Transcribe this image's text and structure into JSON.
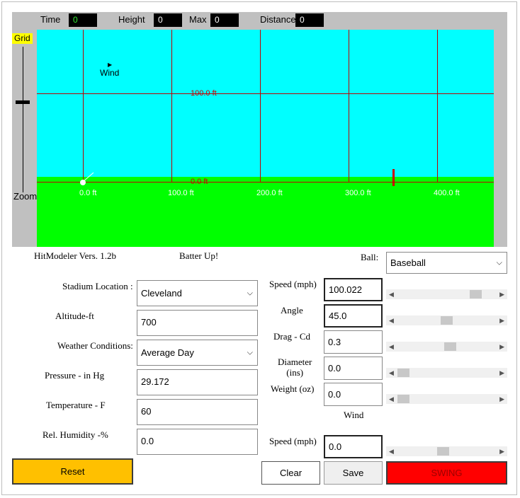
{
  "topbar": {
    "time_label": "Time",
    "time_value": "0",
    "height_label": "Height",
    "height_value": "0",
    "max_label": "Max",
    "max_value": "0",
    "distance_label": "Distance",
    "distance_value": "0"
  },
  "sim": {
    "grid_label": "Grid",
    "zoom_label": "Zoom",
    "wind_label": "Wind",
    "x_ticks": [
      "0.0 ft",
      "100.0 ft",
      "200.0 ft",
      "300.0 ft",
      "400.0 ft"
    ],
    "y_ticks": [
      "100.0 ft",
      "0.0 ft"
    ],
    "colors": {
      "sky": "#00ffff",
      "grass": "#00ff00",
      "gridline": "#c00000"
    }
  },
  "info": {
    "version": "HitModeler Vers. 1.2b",
    "status": "Batter Up!"
  },
  "ball": {
    "label": "Ball:",
    "value": "Baseball"
  },
  "left": {
    "stadium_label": "Stadium Location :",
    "stadium_value": "Cleveland",
    "altitude_label": "Altitude-ft",
    "altitude_value": "700",
    "weather_label": "Weather Conditions:",
    "weather_value": "Average Day",
    "pressure_label": "Pressure - in Hg",
    "pressure_value": "29.172",
    "temperature_label": "Temperature - F",
    "temperature_value": "60",
    "humidity_label": "Rel. Humidity -%",
    "humidity_value": "0.0"
  },
  "right": {
    "speed_label": "Speed (mph)",
    "speed_value": "100.022",
    "angle_label": "Angle",
    "angle_value": "45.0",
    "drag_label": "Drag - Cd",
    "drag_value": "0.3",
    "diameter_label": "Diameter\n(ins)",
    "diameter_value": "0.0",
    "weight_label": "Weight (oz)",
    "weight_value": "0.0",
    "wind_header": "Wind",
    "wind_speed_label": "Speed (mph)",
    "wind_speed_value": "0.0"
  },
  "sliders": {
    "speed": 0.84,
    "angle": 0.5,
    "drag": 0.54,
    "diameter": 0.0,
    "weight": 0.0,
    "wind_speed": 0.46
  },
  "buttons": {
    "reset": "Reset",
    "clear": "Clear",
    "save": "Save",
    "swing": "SWING"
  }
}
